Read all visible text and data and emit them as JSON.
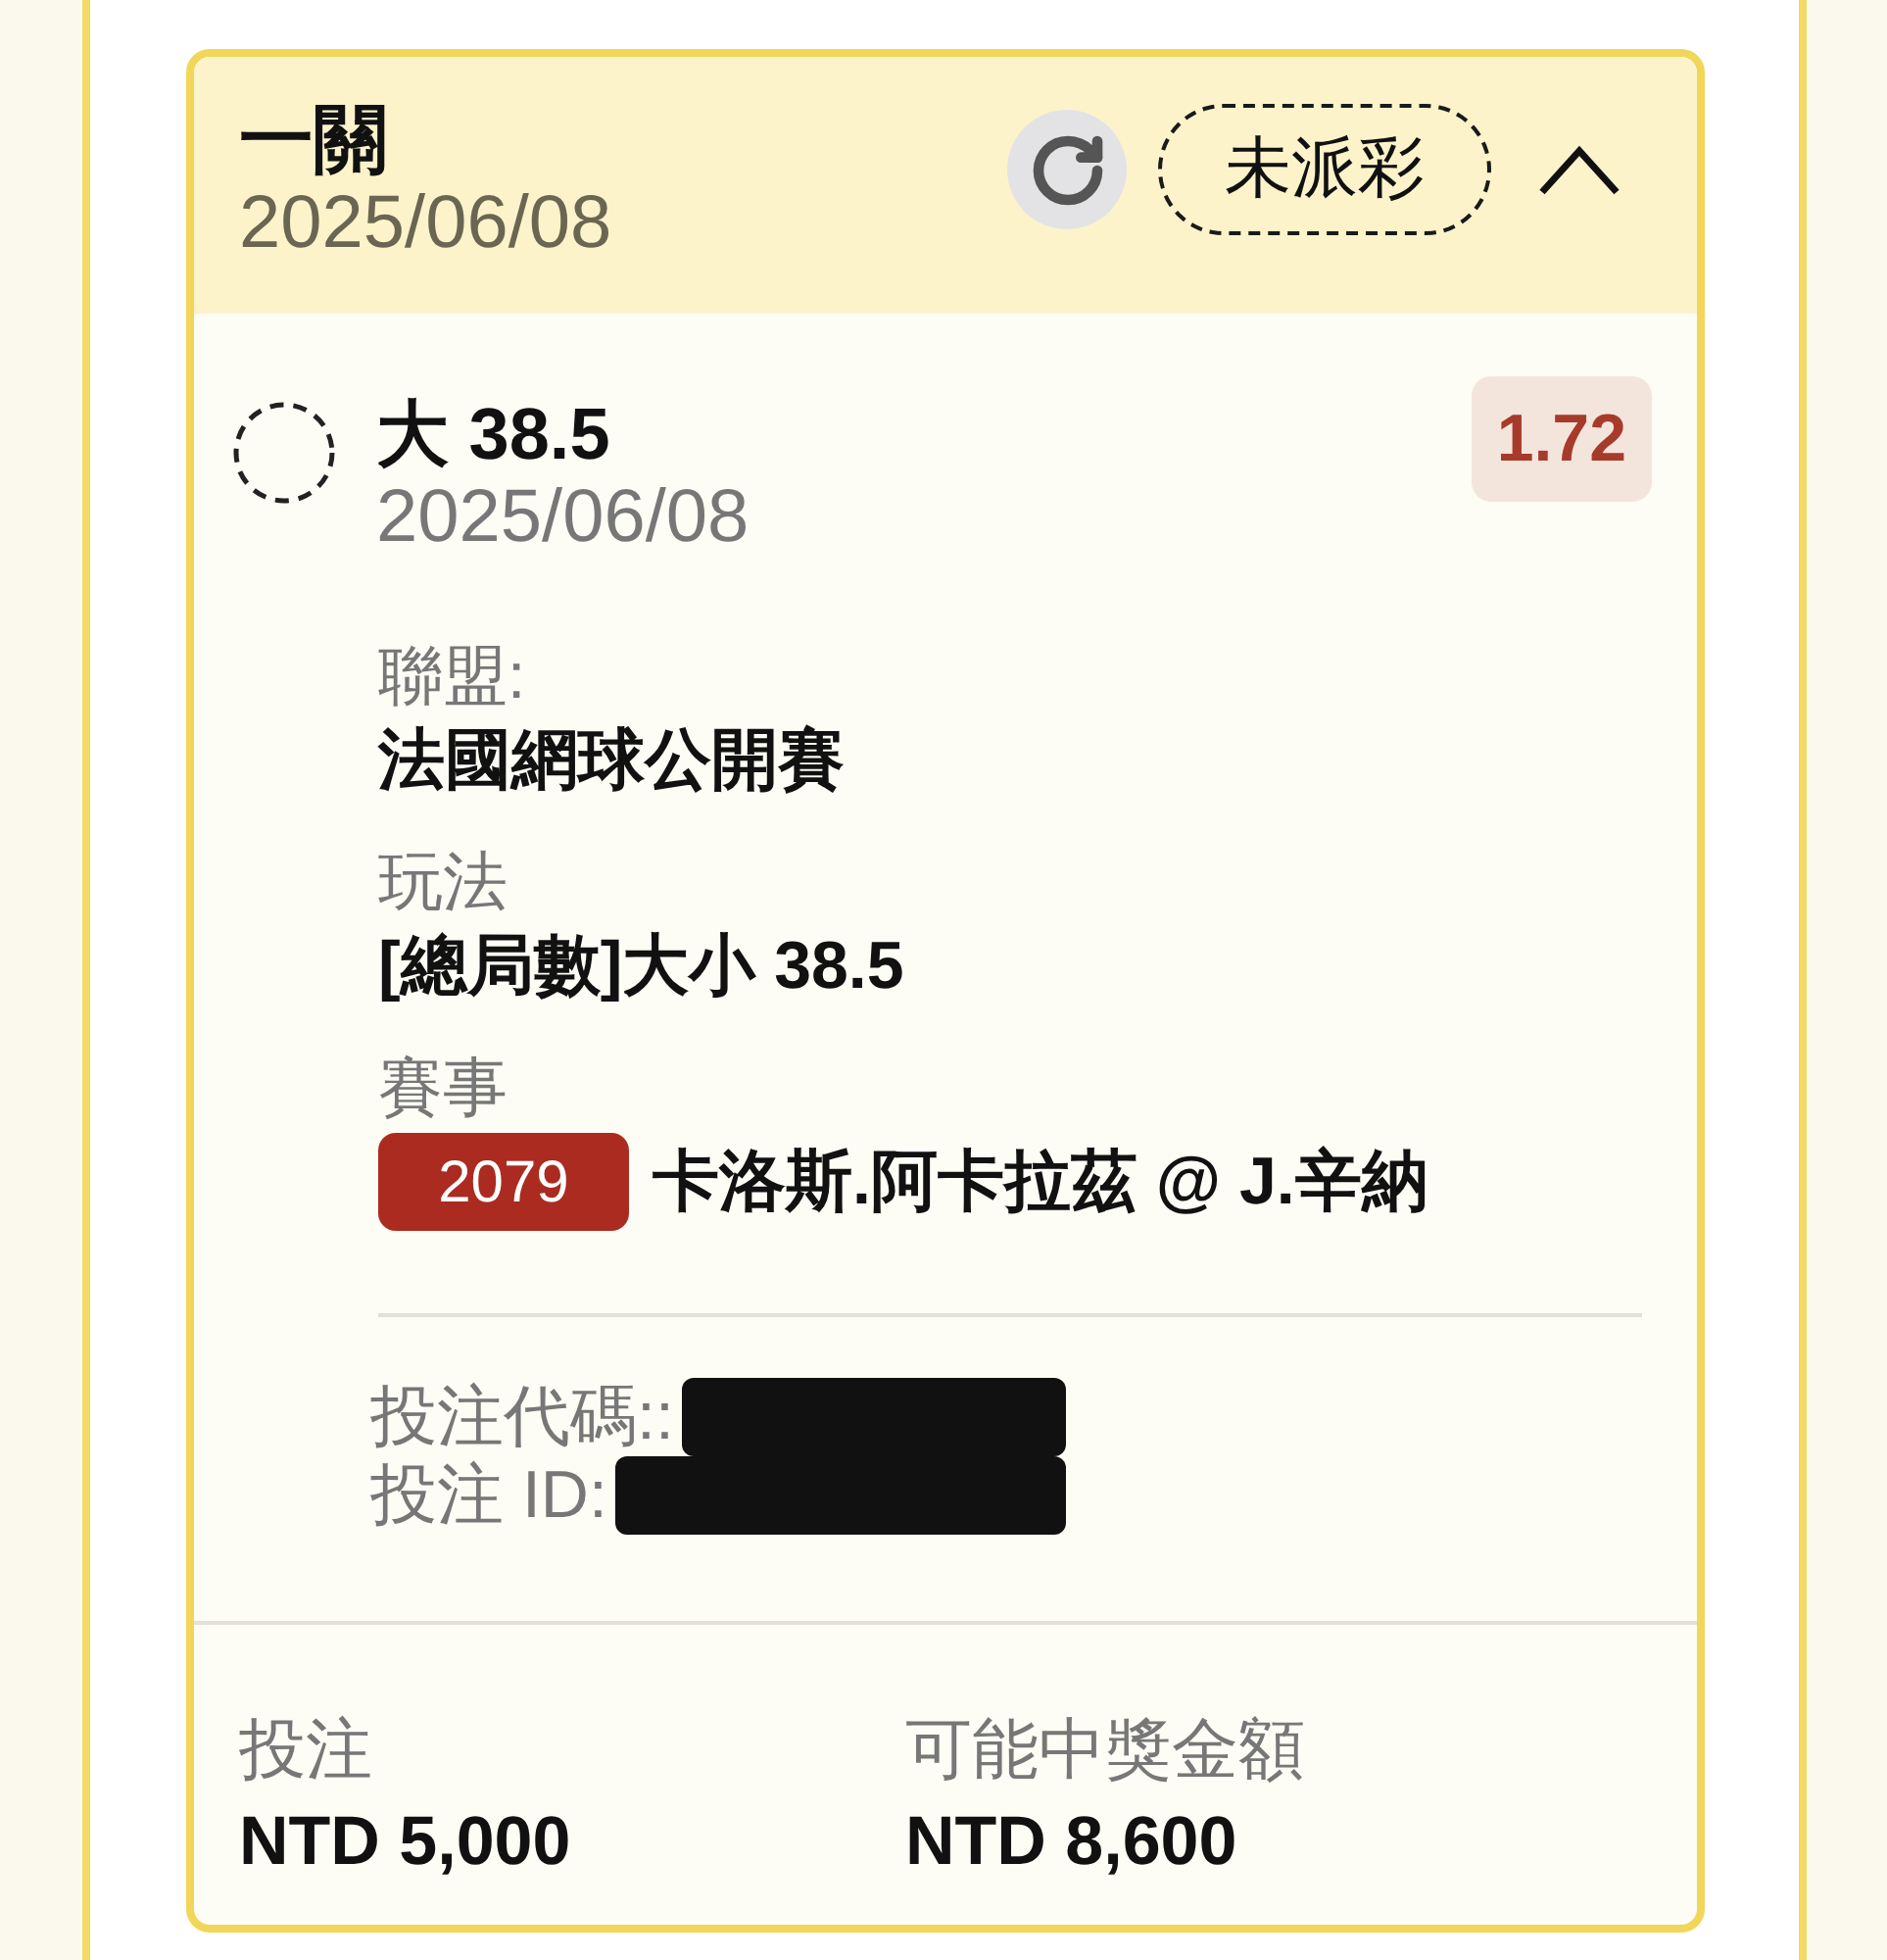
{
  "header": {
    "title": "一關",
    "date": "2025/06/08",
    "status": {
      "label": "未派彩",
      "kind": "pending"
    },
    "expanded": true
  },
  "selection": {
    "name": "大 38.5",
    "date": "2025/06/08",
    "odds": "1.72",
    "settled": false
  },
  "details": [
    {
      "label": "聯盟:",
      "value": "法國網球公開賽"
    },
    {
      "label": "玩法",
      "value": "[總局數]大小 38.5"
    },
    {
      "label": "賽事",
      "value": "卡洛斯.阿卡拉茲 @ J.辛納",
      "code": "2079"
    }
  ],
  "references": [
    {
      "label": "投注代碼::",
      "redacted": true
    },
    {
      "label": "投注 ID:",
      "redacted": true
    }
  ],
  "totals": [
    {
      "label": "投注",
      "value": "NTD 5,000"
    },
    {
      "label": "可能中獎金額",
      "value": "NTD 8,600"
    }
  ]
}
